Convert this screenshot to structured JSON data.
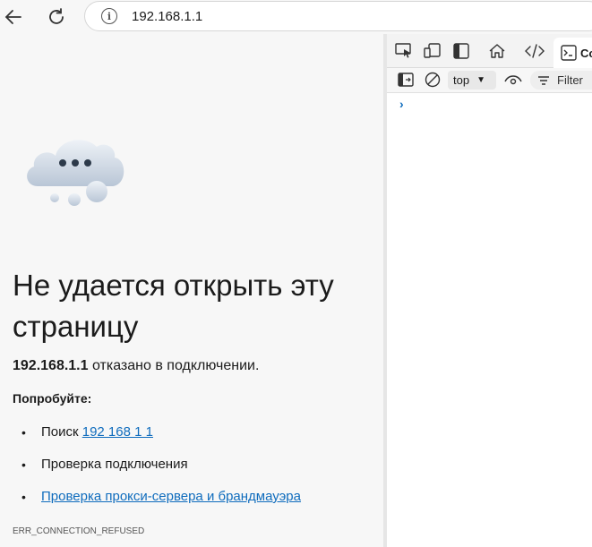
{
  "browser": {
    "url": "192.168.1.1",
    "icons": [
      "back-arrow-icon",
      "refresh-icon",
      "info-icon"
    ]
  },
  "error_page": {
    "title": "Не удается открыть эту страницу",
    "host": "192.168.1.1",
    "message": " отказано в подключении.",
    "try_label": "Попробуйте:",
    "suggestions": [
      {
        "prefix": "Поиск ",
        "link": "192 168 1 1"
      },
      {
        "prefix": "Проверка подключения",
        "link": ""
      },
      {
        "prefix": "",
        "link": "Проверка прокси-сервера и брандмауэра"
      }
    ],
    "error_code": "ERR_CONNECTION_REFUSED"
  },
  "devtools": {
    "active_tab_label": "Co",
    "context": "top",
    "filter_placeholder": "Filter",
    "prompt": "›",
    "accent": "#0f6cbd"
  }
}
